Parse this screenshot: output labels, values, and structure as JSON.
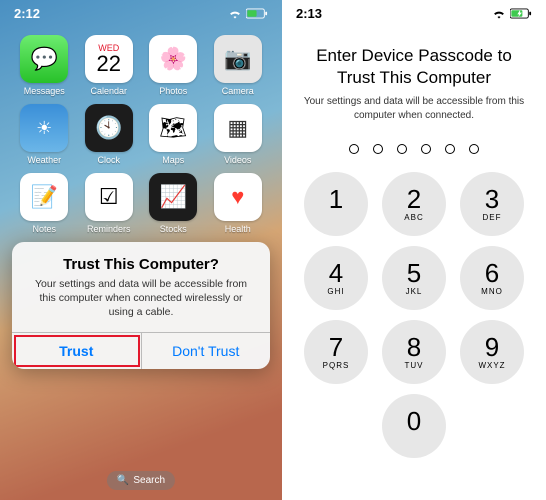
{
  "left": {
    "time": "2:12",
    "apps": [
      {
        "label": "Messages",
        "cls": "ic-messages",
        "glyph": "💬",
        "name": "messages-app"
      },
      {
        "label": "Calendar",
        "cls": "ic-calendar",
        "glyph": "",
        "name": "calendar-app",
        "day": "WED",
        "num": "22"
      },
      {
        "label": "Photos",
        "cls": "ic-photos",
        "glyph": "🌸",
        "name": "photos-app"
      },
      {
        "label": "Camera",
        "cls": "ic-camera",
        "glyph": "📷",
        "name": "camera-app"
      },
      {
        "label": "Weather",
        "cls": "ic-weather",
        "glyph": "☀︎",
        "name": "weather-app"
      },
      {
        "label": "Clock",
        "cls": "ic-clock",
        "glyph": "🕙",
        "name": "clock-app"
      },
      {
        "label": "Maps",
        "cls": "ic-maps",
        "glyph": "🗺",
        "name": "maps-app"
      },
      {
        "label": "Videos",
        "cls": "ic-videos",
        "glyph": "▦",
        "name": "videos-app"
      },
      {
        "label": "Notes",
        "cls": "ic-notes",
        "glyph": "📝",
        "name": "notes-app"
      },
      {
        "label": "Reminders",
        "cls": "ic-reminders",
        "glyph": "☑︎",
        "name": "reminders-app"
      },
      {
        "label": "Stocks",
        "cls": "ic-stocks",
        "glyph": "📈",
        "name": "stocks-app"
      },
      {
        "label": "Health",
        "cls": "ic-health",
        "glyph": "♥",
        "name": "health-app"
      }
    ],
    "dialog": {
      "title": "Trust This Computer?",
      "message": "Your settings and data will be accessible from this computer when connected wirelessly or using a cable.",
      "trust": "Trust",
      "dontTrust": "Don't Trust"
    },
    "search": "Search"
  },
  "right": {
    "time": "2:13",
    "title": "Enter Device Passcode to Trust This Computer",
    "subtitle": "Your settings and data will be accessible from this computer when connected.",
    "keys": [
      {
        "n": "1",
        "s": ""
      },
      {
        "n": "2",
        "s": "ABC"
      },
      {
        "n": "3",
        "s": "DEF"
      },
      {
        "n": "4",
        "s": "GHI"
      },
      {
        "n": "5",
        "s": "JKL"
      },
      {
        "n": "6",
        "s": "MNO"
      },
      {
        "n": "7",
        "s": "PQRS"
      },
      {
        "n": "8",
        "s": "TUV"
      },
      {
        "n": "9",
        "s": "WXYZ"
      },
      {
        "n": "",
        "s": "",
        "empty": true
      },
      {
        "n": "0",
        "s": ""
      },
      {
        "n": "",
        "s": "",
        "empty": true
      }
    ]
  }
}
